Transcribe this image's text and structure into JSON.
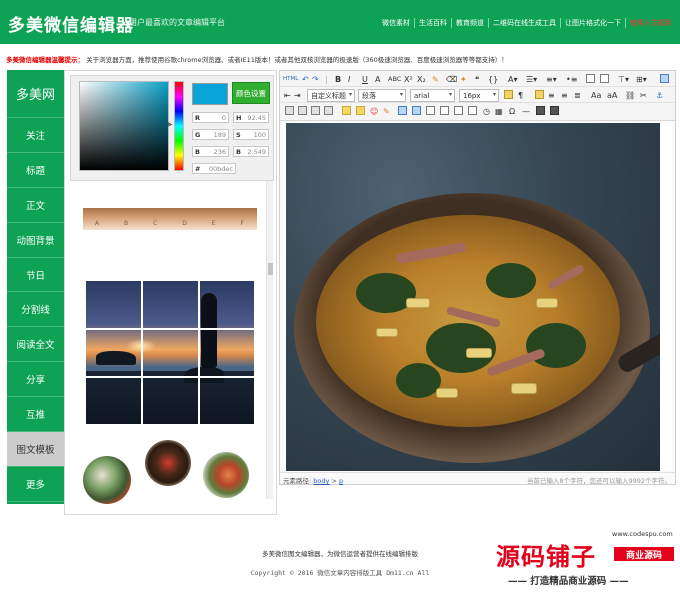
{
  "header": {
    "logo": "多美微信编辑器",
    "slogan": "用户最喜欢的文章编辑平台",
    "nav": [
      "微信素材",
      "生活百科",
      "教育频道",
      "二维码在线生成工具",
      "让图片格式化一下",
      "使用人员福利"
    ]
  },
  "notice": {
    "label": "多美微信编辑器温馨提示：",
    "text": "关于浏览器方面，推荐使用谷歌chrome浏览器、或者IE11版本！或者其他双核浏览器的极速版（360极速浏览器、百度极速浏览器等等都支持）！"
  },
  "sidebar": {
    "brand": "多美网",
    "items": [
      "关注",
      "标题",
      "正文",
      "动图背景",
      "节日",
      "分割线",
      "阅读全文",
      "分享",
      "互推",
      "图文模板",
      "更多"
    ],
    "active_index": 9
  },
  "color_picker": {
    "set_button": "颜色设置",
    "swatch_color": "#0aa5d8",
    "fields": {
      "R": "0",
      "G": "189",
      "B": "236",
      "H": "92.45",
      "S": "100",
      "B2": "2.549",
      "hex": "00bdec"
    },
    "labels": {
      "R": "R",
      "G": "G",
      "B": "B",
      "H": "H",
      "S": "S",
      "B2": "B",
      "hash": "#"
    }
  },
  "templates": {
    "banner_letters": [
      "A",
      "B",
      "C",
      "D",
      "E",
      "F"
    ]
  },
  "editor": {
    "toolbar": {
      "html_label": "HTML",
      "heading": "自定义标题",
      "paragraph": "段落",
      "font": "arial",
      "font_size": "16px"
    },
    "status": {
      "path_label": "元素路径:",
      "path_body": "body",
      "path_sep": ">",
      "path_p": "p",
      "count": "当前已输入8个字符，您还可以输入9992个字符。"
    }
  },
  "footer": {
    "line1": "多美微信图文编辑器，为微信运营者提供在线编辑排版",
    "line2": "Copyright © 2016 微信文章内容排版工具 Dm11.cn All"
  },
  "watermark": {
    "brand": "源码铺子",
    "url": "www.codespu.com",
    "tag": "商业源码",
    "sub": "—— 打造精品商业源码 ——"
  },
  "colors": {
    "brand_green": "#0ea255",
    "accent_red": "#e2001a",
    "link_blue": "#2a5fc0"
  }
}
